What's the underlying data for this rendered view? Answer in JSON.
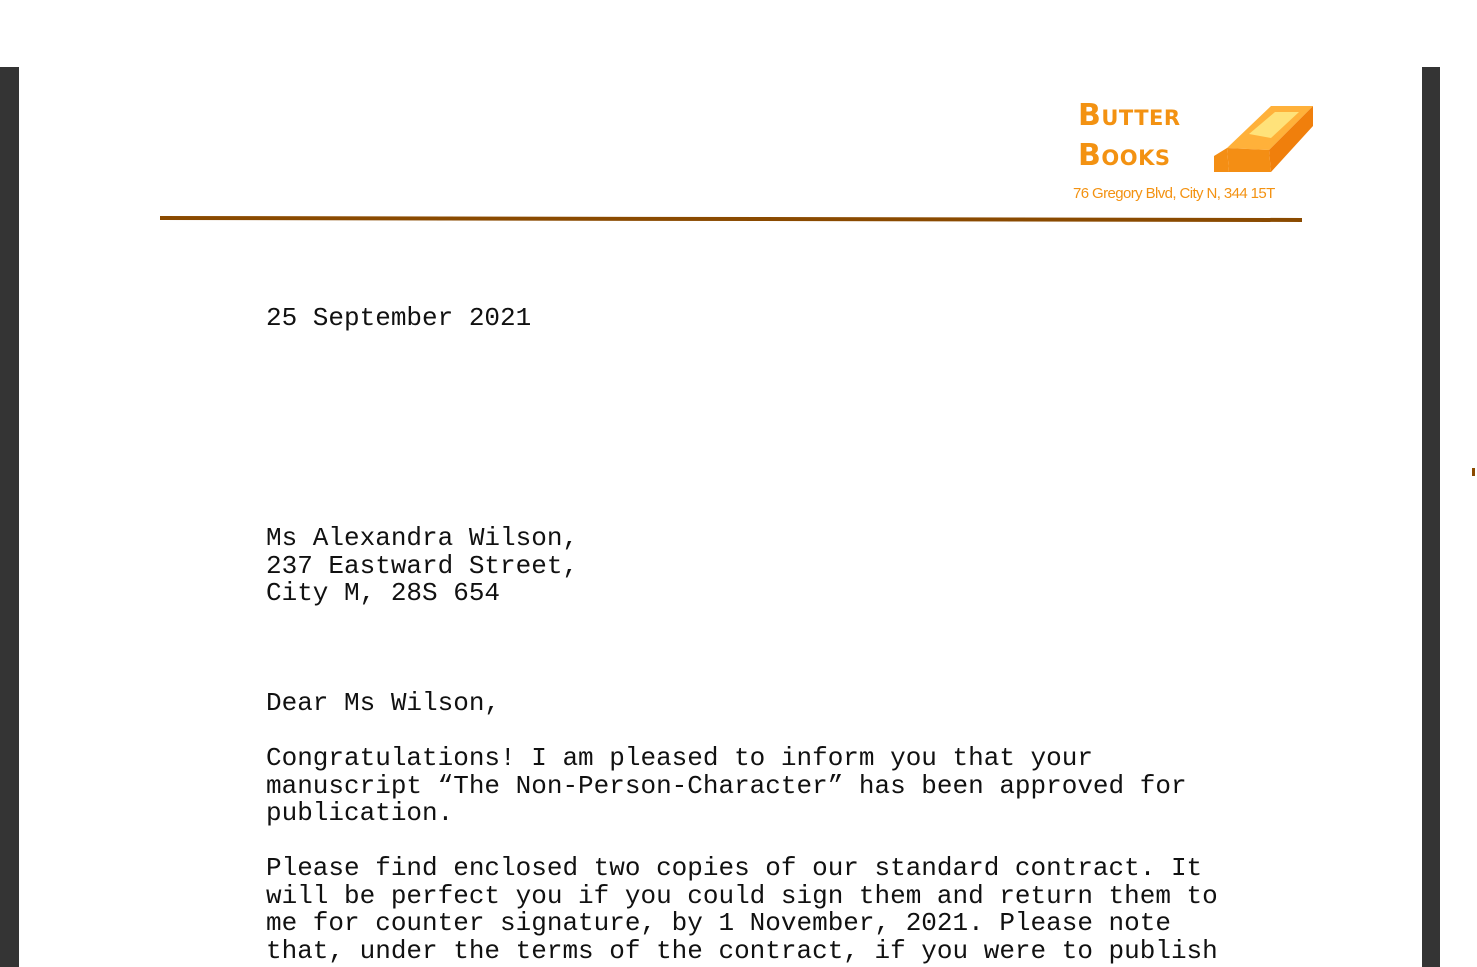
{
  "letterhead": {
    "brand_line_1": "Butter",
    "brand_line_2": "Books",
    "address": "76 Gregory Blvd, City N, 344 15T",
    "brand_color": "#f39212",
    "rule_color": "#8a4a00",
    "logo_icon": "butter-block-icon"
  },
  "letter": {
    "date": "25 September 2021",
    "recipient": {
      "name_line": "Ms Alexandra Wilson,",
      "street_line": "237 Eastward Street,",
      "city_line": "City M, 28S 654"
    },
    "salutation": "Dear Ms Wilson,",
    "paragraph_1": [
      "Congratulations! I am pleased to inform you that your",
      "manuscript “The Non-Person-Character” has been approved for",
      "publication."
    ],
    "paragraph_2": [
      "Please find enclosed two copies of our standard contract. It",
      "will be perfect you if you could sign them and return them to",
      "me for counter signature, by 1 November, 2021. Please note",
      "that, under the terms of the contract, if you were to publish"
    ]
  }
}
